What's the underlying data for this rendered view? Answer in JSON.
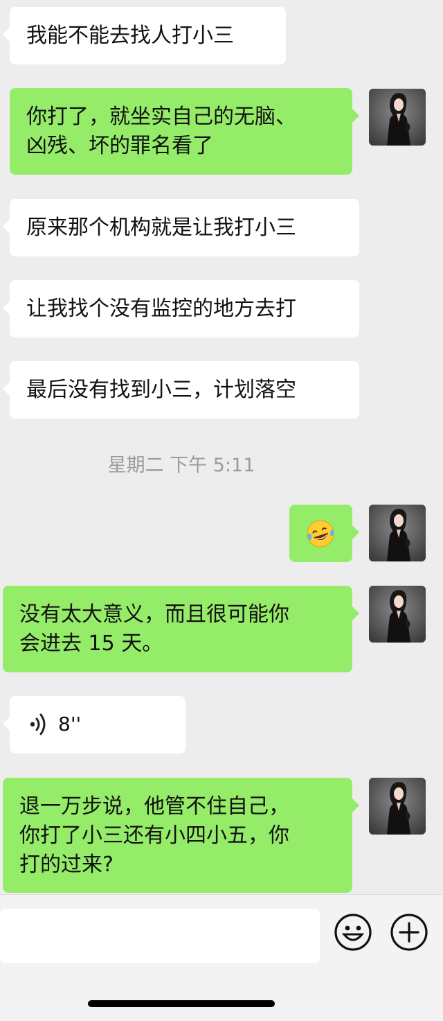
{
  "chat": {
    "messages": [
      {
        "side": "in",
        "text": "我能不能去找人打小三"
      },
      {
        "side": "out",
        "text": "你打了，就坐实自己的无脑、\n凶残、坏的罪名看了"
      },
      {
        "side": "in",
        "text": "原来那个机构就是让我打小三"
      },
      {
        "side": "in",
        "text": "让我找个没有监控的地方去打"
      },
      {
        "side": "in",
        "text": "最后没有找到小三，计划落空"
      },
      {
        "side": "out",
        "emoji": "laughing-crying-emoji"
      },
      {
        "side": "out",
        "text": "没有太大意义，而且很可能你\n会进去 15 天。"
      },
      {
        "side": "in",
        "voice": true,
        "duration": "8''"
      },
      {
        "side": "out",
        "text": "退一万步说，他管不住自己，\n你打了小三还有小四小五，你\n打的过来?"
      }
    ],
    "timestamp": "星期二 下午 5:11"
  },
  "input_bar": {
    "emoji_icon": "smiley-face-icon",
    "plus_icon": "plus-circle-icon"
  },
  "colors": {
    "background": "#ededed",
    "incoming_bubble": "#ffffff",
    "outgoing_bubble": "#95ec69",
    "timestamp": "#9b9b9b"
  }
}
